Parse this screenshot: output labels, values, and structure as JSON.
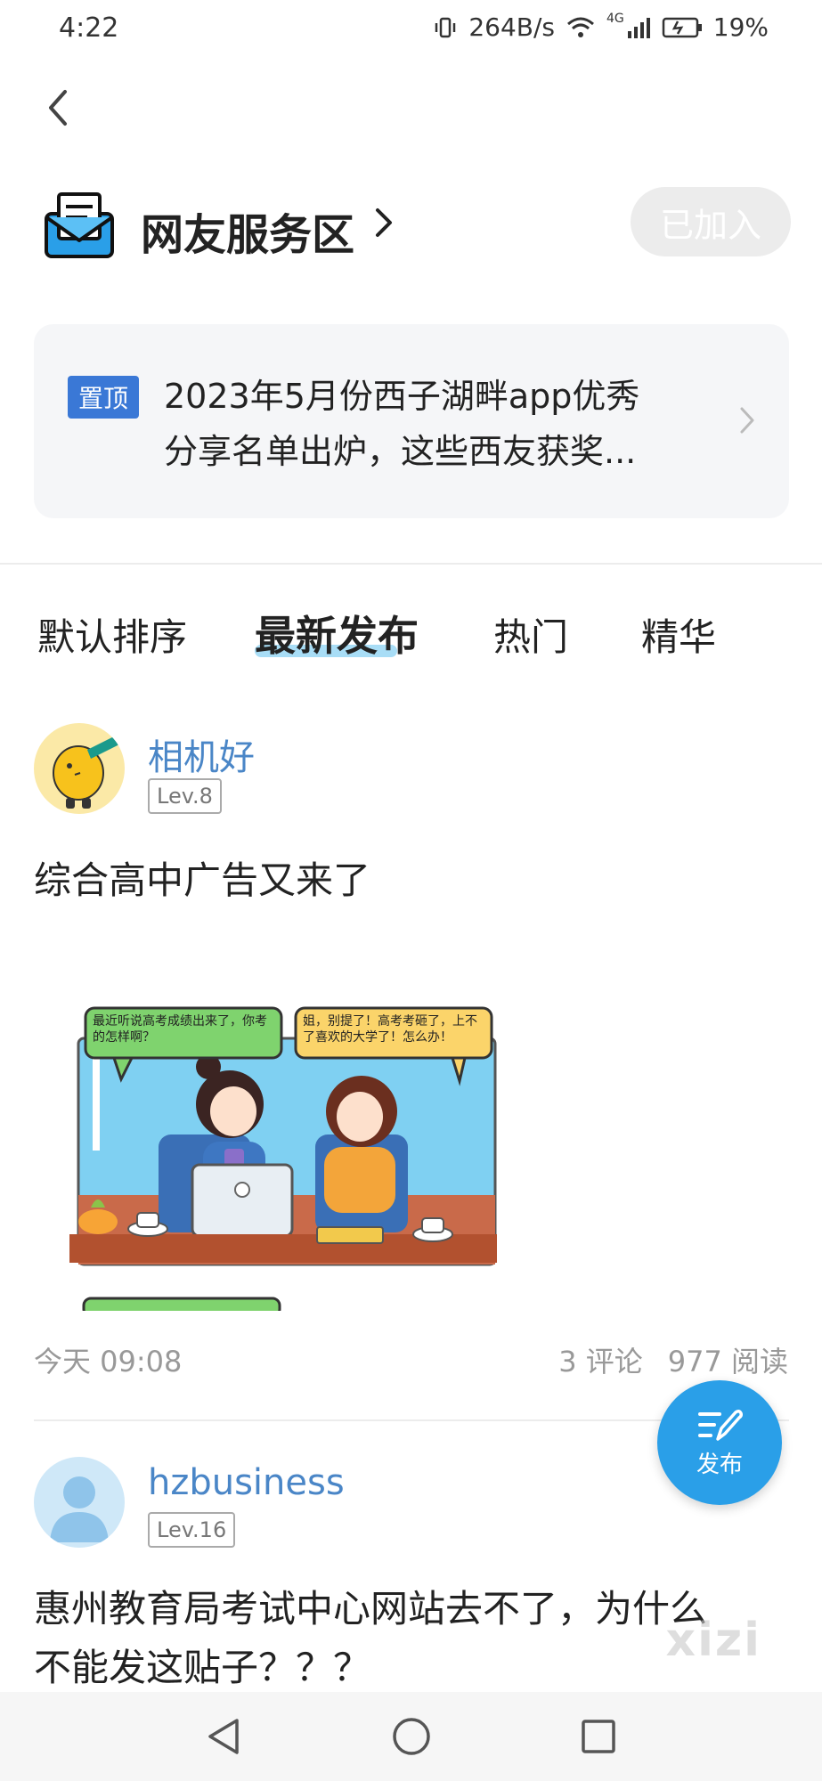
{
  "status_bar": {
    "time": "4:22",
    "speed": "264B/s",
    "network": "4G",
    "battery": "19%"
  },
  "forum": {
    "title": "网友服务区",
    "join_label": "已加入"
  },
  "pinned": {
    "tag": "置顶",
    "line1": "2023年5月份西子湖畔app优秀",
    "line2": "分享名单出炉，这些西友获奖..."
  },
  "tabs": [
    {
      "label": "默认排序",
      "active": false
    },
    {
      "label": "最新发布",
      "active": true
    },
    {
      "label": "热门",
      "active": false
    },
    {
      "label": "精华",
      "active": false
    }
  ],
  "posts": [
    {
      "username": "相机好",
      "level": "Lev.8",
      "text": "综合高中广告又来了",
      "time": "今天 09:08",
      "comments": "3 评论",
      "reads": "977 阅读",
      "comic": {
        "bubble_left": "最近听说高考成绩出来了，你考的怎样啊？",
        "bubble_right": "姐，别提了！高考考砸了，上不了喜欢的大学了！怎么办！"
      }
    },
    {
      "username": "hzbusiness",
      "level": "Lev.16",
      "text_line1": "惠州教育局考试中心网站去不了，为什么",
      "text_line2": "不能发这贴子？？？"
    }
  ],
  "fab": {
    "label": "发布"
  },
  "watermark": "xizi",
  "colors": {
    "accent": "#2a9fe8",
    "username": "#4a86c7",
    "pin_tag": "#3a78d6"
  }
}
